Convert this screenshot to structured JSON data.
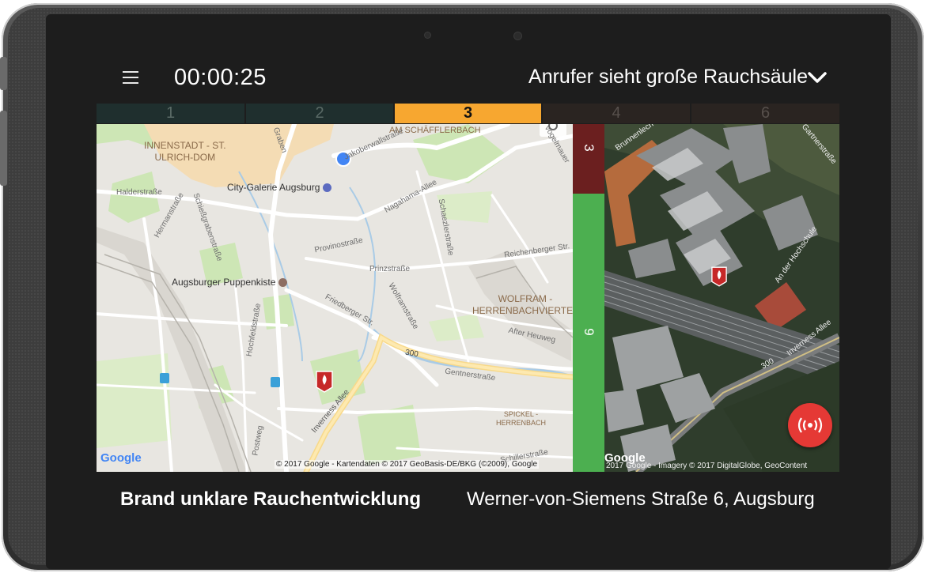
{
  "header": {
    "timer": "00:00:25",
    "status_title": "Anrufer sieht große Rauchsäule",
    "menu_icon": "hamburger-menu-icon",
    "dropdown_icon": "chevron-down-icon"
  },
  "tabs": [
    {
      "label": "1",
      "active": false
    },
    {
      "label": "2",
      "active": false
    },
    {
      "label": "3",
      "active": true
    },
    {
      "label": "4",
      "active": false
    },
    {
      "label": "6",
      "active": false
    }
  ],
  "colors": {
    "accent_orange": "#f7a730",
    "strip_dark_red": "#6b1f1f",
    "strip_green": "#4caf50",
    "fab_red": "#e53935",
    "marker_red": "#c62828",
    "screen_bg": "#1d1d1d"
  },
  "map_left": {
    "districts": [
      {
        "text": "INNENSTADT - ST.\nULRICH-DOM"
      },
      {
        "text": "WOLFRAM -\nHERRENBACHVIERTEL"
      },
      {
        "text": "SPICKEL -\nHERRENBACH"
      },
      {
        "text": "AM SCHÄFFLERBACH"
      }
    ],
    "pois": [
      {
        "text": "City-Galerie Augsburg"
      },
      {
        "text": "Augsburger Puppenkiste"
      }
    ],
    "streets": [
      "Halderstraße",
      "Hermanstraße",
      "Schießgrabenstraße",
      "Provinostraße",
      "Prinzstraße",
      "Nagahama-Allee",
      "Schaezlerstraße",
      "Reichenberger Str.",
      "Friedberger Str.",
      "Wolframstraße",
      "Hochfeldstraße",
      "Gentnerstraße",
      "Inverness Allee",
      "After Heuweg",
      "Postweg",
      "Schillerstraße",
      "Jakoberwallstraße",
      "Vogelmauer",
      "Graben"
    ],
    "road_number": "300",
    "google_logo": "Google",
    "attribution": "© 2017 Google - Kartendaten © 2017 GeoBasis-DE/BKG (©2009), Google"
  },
  "strip": {
    "top_number": "3",
    "bottom_number": "9"
  },
  "map_right": {
    "streets": [
      "Brunnenlech",
      "Gartnerstraße",
      "An der Hochschule",
      "Inverness Allee"
    ],
    "road_number": "300",
    "google_logo": "Google",
    "attribution": "2017 Google - Imagery © 2017 DigitalGlobe, GeoContent",
    "fab_icon": "broadcast-icon"
  },
  "footer": {
    "incident_type": "Brand unklare Rauchentwicklung",
    "address": "Werner-von-Siemens Straße 6, Augsburg"
  }
}
